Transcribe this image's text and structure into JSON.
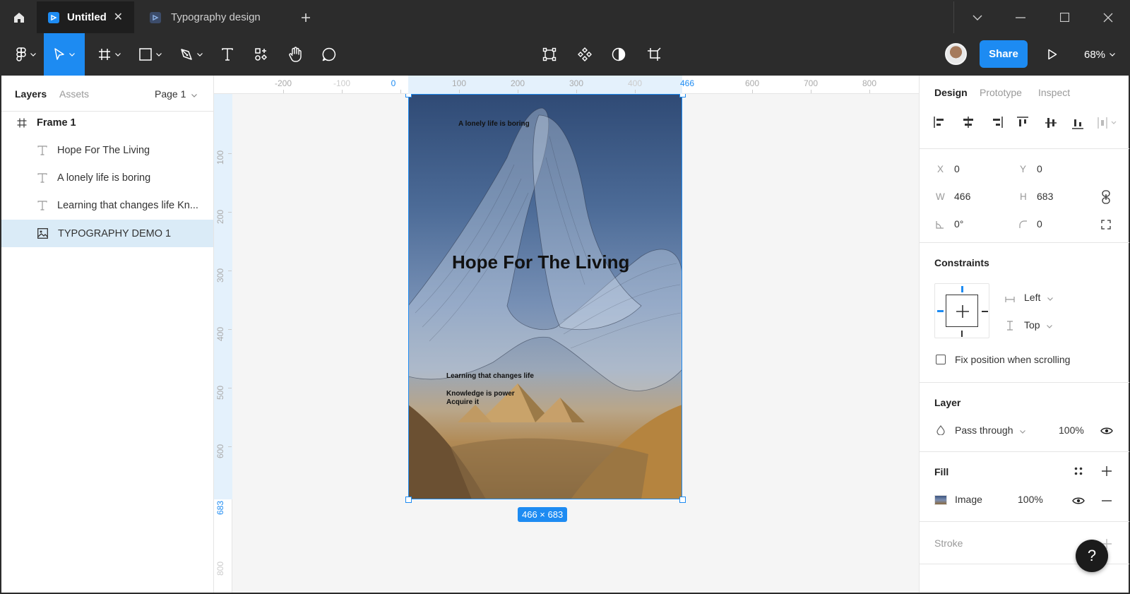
{
  "titlebar": {
    "tabs": [
      {
        "label": "Untitled",
        "active": true
      },
      {
        "label": "Typography design",
        "active": false
      }
    ]
  },
  "toolbar": {
    "share_label": "Share",
    "zoom": "68%"
  },
  "left_panel": {
    "tabs": [
      "Layers",
      "Assets"
    ],
    "page_selector": "Page 1",
    "layers": [
      {
        "name": "Frame 1",
        "type": "frame",
        "icon": "frame-icon"
      },
      {
        "name": "Hope For The Living",
        "type": "text",
        "icon": "text-icon"
      },
      {
        "name": "A lonely life is boring",
        "type": "text",
        "icon": "text-icon"
      },
      {
        "name": "Learning that changes life Kn...",
        "type": "text",
        "icon": "text-icon"
      },
      {
        "name": "TYPOGRAPHY DEMO 1",
        "type": "image",
        "icon": "image-icon",
        "selected": true
      }
    ]
  },
  "rulers": {
    "top": [
      "-200",
      "-100",
      "0",
      "100",
      "200",
      "300",
      "400",
      "466",
      "600",
      "700",
      "800"
    ],
    "left": [
      "100",
      "200",
      "300",
      "400",
      "500",
      "600",
      "683",
      "800"
    ]
  },
  "canvas": {
    "frame_texts": {
      "small_top": "A lonely life is boring",
      "title": "Hope For The Living",
      "line1": "Learning that changes life",
      "line2": "Knowledge is power",
      "line3": "Acquire it"
    },
    "size_badge": "466 × 683"
  },
  "right_panel": {
    "tabs": [
      "Design",
      "Prototype",
      "Inspect"
    ],
    "props": {
      "x_label": "X",
      "x": "0",
      "y_label": "Y",
      "y": "0",
      "w_label": "W",
      "w": "466",
      "h_label": "H",
      "h": "683",
      "rotation": "0°",
      "radius": "0"
    },
    "constraints": {
      "title": "Constraints",
      "horizontal": "Left",
      "vertical": "Top",
      "fix_scroll_label": "Fix position when scrolling"
    },
    "layer": {
      "title": "Layer",
      "blend": "Pass through",
      "opacity": "100%"
    },
    "fill": {
      "title": "Fill",
      "type": "Image",
      "opacity": "100%"
    },
    "stroke": {
      "title": "Stroke"
    }
  },
  "help_label": "?",
  "colors": {
    "accent": "#1d8bf2",
    "chrome": "#2c2c2c",
    "selection": "#daebf7"
  }
}
